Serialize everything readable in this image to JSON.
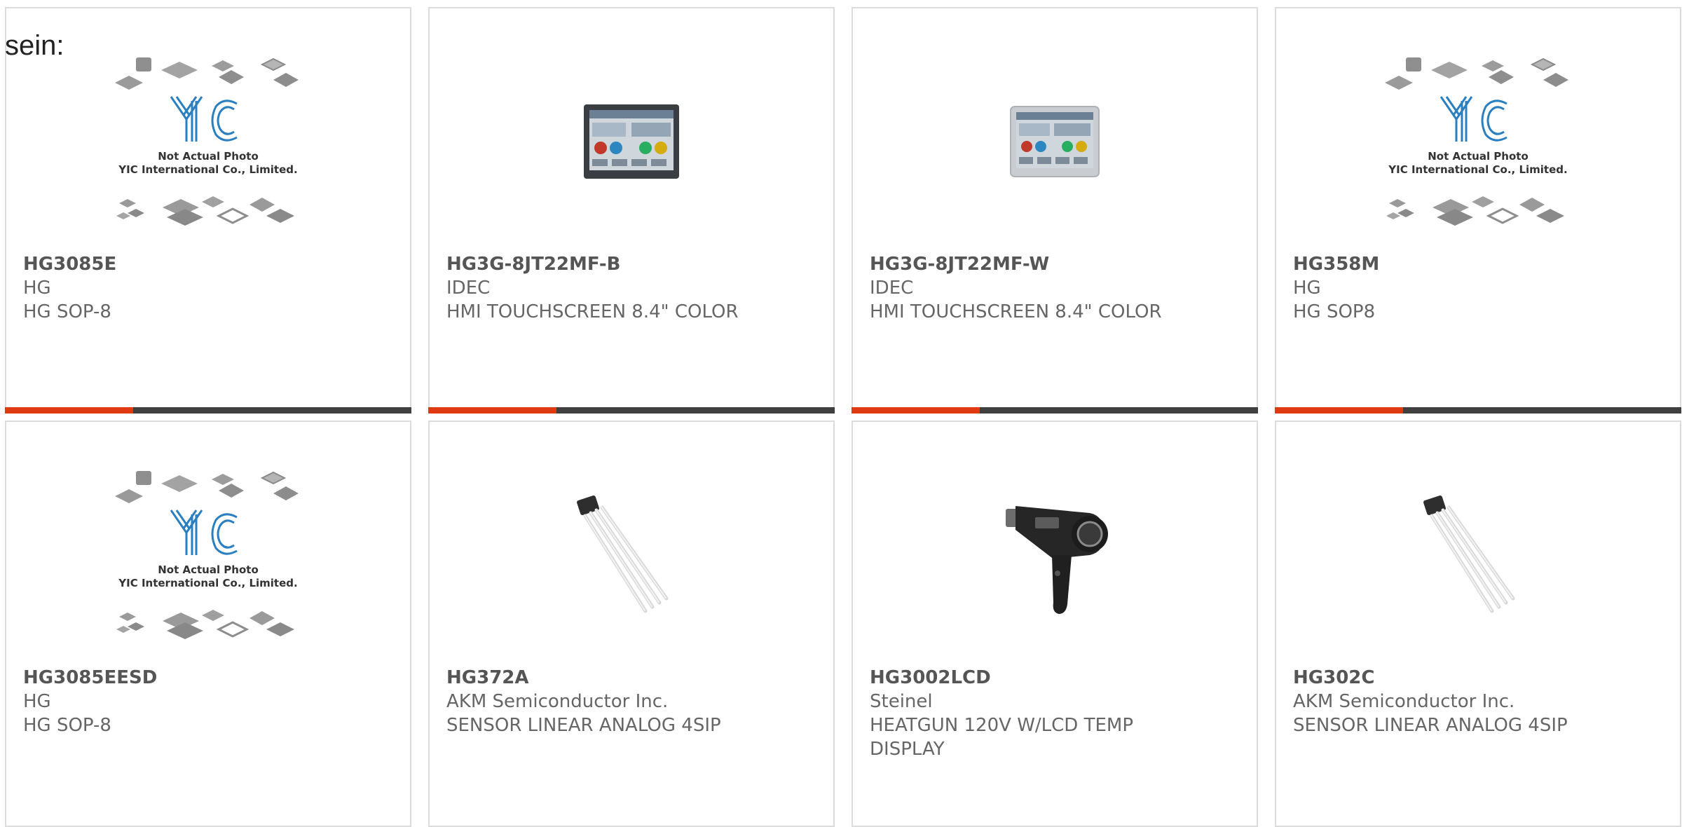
{
  "heading": "sein:",
  "placeholder": {
    "line1": "Not Actual Photo",
    "line2": "YIC International Co., Limited."
  },
  "products": [
    {
      "part": "HG3085E",
      "maker": "HG",
      "desc": "HG SOP-8",
      "image": "yic-placeholder-icon"
    },
    {
      "part": "HG3G-8JT22MF-B",
      "maker": "IDEC",
      "desc": "HMI TOUCHSCREEN 8.4\" COLOR",
      "image": "touchscreen-black-icon"
    },
    {
      "part": "HG3G-8JT22MF-W",
      "maker": "IDEC",
      "desc": "HMI TOUCHSCREEN 8.4\" COLOR",
      "image": "touchscreen-silver-icon"
    },
    {
      "part": "HG358M",
      "maker": "HG",
      "desc": "HG SOP8",
      "image": "yic-placeholder-icon"
    },
    {
      "part": "HG3085EESD",
      "maker": "HG",
      "desc": "HG SOP-8",
      "image": "yic-placeholder-icon"
    },
    {
      "part": "HG372A",
      "maker": "AKM Semiconductor Inc.",
      "desc": "SENSOR LINEAR ANALOG 4SIP",
      "image": "hall-sensor-icon"
    },
    {
      "part": "HG3002LCD",
      "maker": "Steinel",
      "desc": "HEATGUN 120V W/LCD TEMP DISPLAY",
      "image": "heat-gun-icon"
    },
    {
      "part": "HG302C",
      "maker": "AKM Semiconductor Inc.",
      "desc": "SENSOR LINEAR ANALOG 4SIP",
      "image": "hall-sensor-icon"
    }
  ],
  "colors": {
    "accent": "#e03a12",
    "bar": "#3f3f3f",
    "yic_logo": "#2a7fc0",
    "border": "#dcdcdc"
  }
}
